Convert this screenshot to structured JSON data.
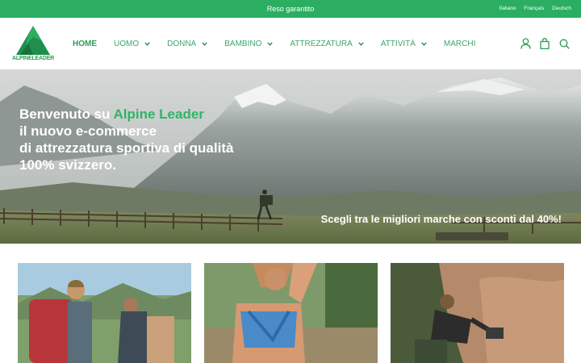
{
  "topbar": {
    "promo": "Reso garantito",
    "languages": [
      "Italiano",
      "Français",
      "Deutsch"
    ]
  },
  "logo": {
    "text": "ALPINELEADER"
  },
  "nav": {
    "items": [
      {
        "label": "HOME",
        "active": true,
        "has_dropdown": false
      },
      {
        "label": "UOMO",
        "active": false,
        "has_dropdown": true
      },
      {
        "label": "DONNA",
        "active": false,
        "has_dropdown": true
      },
      {
        "label": "BAMBINO",
        "active": false,
        "has_dropdown": true
      },
      {
        "label": "ATTREZZATURA",
        "active": false,
        "has_dropdown": true
      },
      {
        "label": "ATTIVITÀ",
        "active": false,
        "has_dropdown": true
      },
      {
        "label": "MARCHI",
        "active": false,
        "has_dropdown": false
      }
    ]
  },
  "header_icons": [
    "user-icon",
    "shopping-bag-icon",
    "search-icon"
  ],
  "hero": {
    "line1_prefix": "Benvenuto su ",
    "line1_brand": "Alpine Leader",
    "line2": "il nuovo e-commerce",
    "line3": "di attrezzatura sportiva di qualità",
    "line4": "100% svizzero.",
    "tagline": "Scegli tra le migliori marche con sconti dal 40%!"
  },
  "colors": {
    "brand_green": "#2bae62",
    "nav_green": "#3aa868",
    "text_white": "#ffffff"
  }
}
